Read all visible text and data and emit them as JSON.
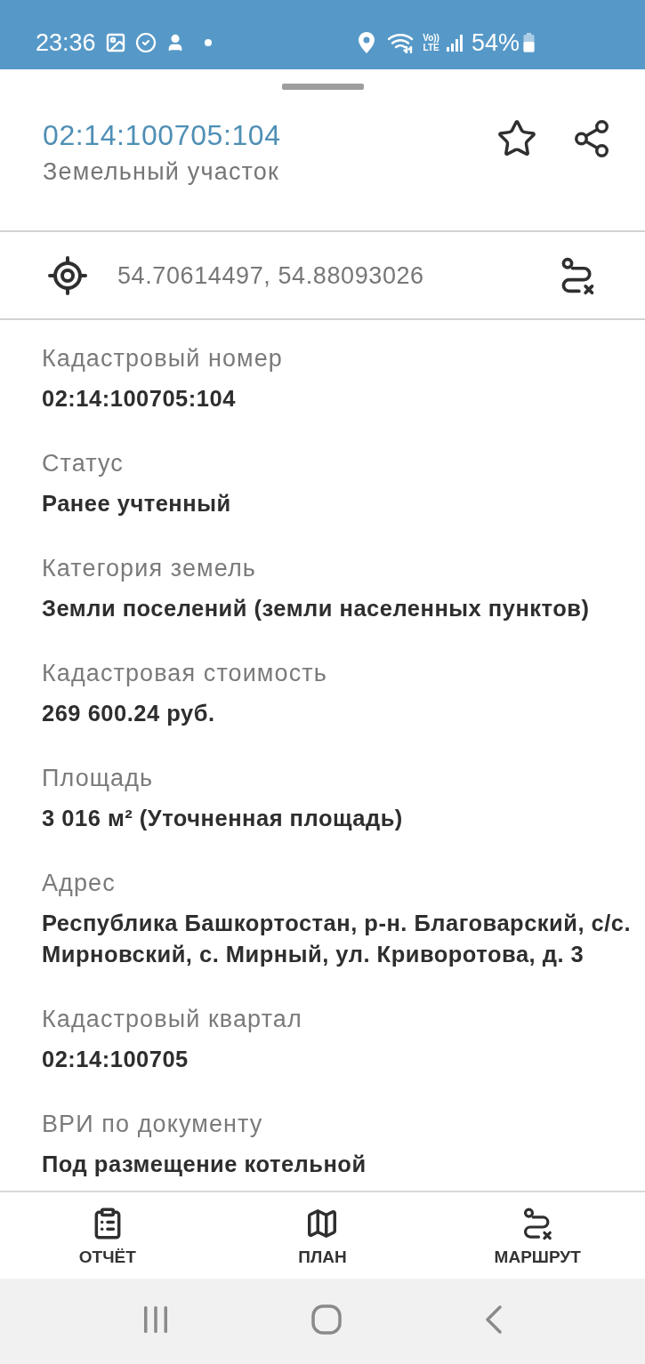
{
  "status_bar": {
    "time": "23:36",
    "volte_top": "Vo))",
    "volte_bottom": "LTE",
    "battery": "54%"
  },
  "header": {
    "title": "02:14:100705:104",
    "subtitle": "Земельный участок",
    "favorite": false
  },
  "coordinates": {
    "text": "54.70614497, 54.88093026"
  },
  "fields": [
    {
      "label": "Кадастровый номер",
      "value": "02:14:100705:104"
    },
    {
      "label": "Статус",
      "value": "Ранее учтенный"
    },
    {
      "label": "Категория земель",
      "value": "Земли поселений (земли населенных пунктов)"
    },
    {
      "label": "Кадастровая стоимость",
      "value": "269 600.24 руб."
    },
    {
      "label": "Площадь",
      "value": "3 016 м² (Уточненная площадь)"
    },
    {
      "label": "Адрес",
      "value": "Республика Башкортостан, р-н. Благоварский, с/с. Мирновский, с. Мирный, ул. Криворотова, д. 3"
    },
    {
      "label": "Кадастровый квартал",
      "value": "02:14:100705"
    },
    {
      "label": "ВРИ по документу",
      "value": "Под размещение котельной"
    }
  ],
  "bottom_nav": [
    {
      "kind": "report",
      "label": "ОТЧЁТ"
    },
    {
      "kind": "map",
      "label": "ПЛАН"
    },
    {
      "kind": "route",
      "label": "МАРШРУТ"
    }
  ]
}
